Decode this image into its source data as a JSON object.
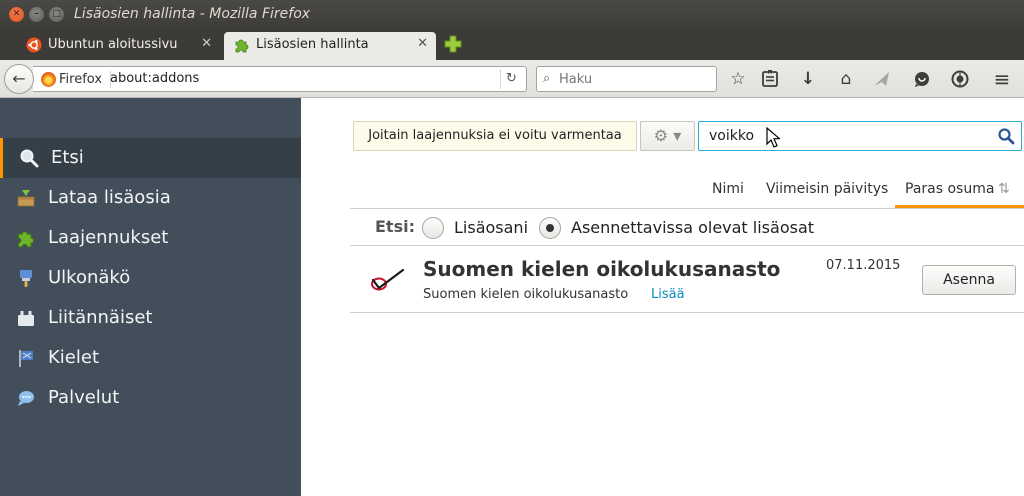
{
  "window": {
    "title": "Lisäosien hallinta - Mozilla Firefox",
    "close_glyph": "✕",
    "min_glyph": "–",
    "max_glyph": "□"
  },
  "tabs": [
    {
      "label": "Ubuntun aloitussivu",
      "icon": "ubuntu-icon",
      "close": "✕"
    },
    {
      "label": "Lisäosien hallinta",
      "icon": "puzzle-icon",
      "close": "✕"
    }
  ],
  "navbar": {
    "back_glyph": "←",
    "identity": "Firefox",
    "url": "about:addons",
    "reload_glyph": "↻",
    "search_placeholder": "Haku",
    "search_glyph": "⌕",
    "bookmark_glyph": "☆",
    "download_glyph": "↓",
    "home_glyph": "⌂",
    "menu_glyph": "≡"
  },
  "sidebar": {
    "items": [
      {
        "label": "Etsi",
        "icon": "search-icon",
        "selected": true
      },
      {
        "label": "Lataa lisäosia",
        "icon": "package-icon"
      },
      {
        "label": "Laajennukset",
        "icon": "puzzle-icon"
      },
      {
        "label": "Ulkonäkö",
        "icon": "brush-icon"
      },
      {
        "label": "Liitännäiset",
        "icon": "plugin-icon"
      },
      {
        "label": "Kielet",
        "icon": "language-flag-icon"
      },
      {
        "label": "Palvelut",
        "icon": "speech-bubble-icon"
      }
    ]
  },
  "main": {
    "warning": "Joitain laajennuksia ei voitu varmentaa",
    "gear_glyph": "⚙ ▾",
    "search_value": "voikko",
    "sort": {
      "name": "Nimi",
      "updated": "Viimeisin päivitys",
      "best": "Paras osuma",
      "best_arrow": "⇅"
    },
    "filter": {
      "label": "Etsi:",
      "option_mine": "Lisäosani",
      "option_available": "Asennettavissa olevat lisäosat",
      "selected": "option_available"
    },
    "result": {
      "name": "Suomen kielen oikolukusanasto",
      "date": "07.11.2015",
      "description": "Suomen kielen oikolukusanasto",
      "more": "Lisää",
      "install": "Asenna",
      "icon": "checkmark-icon"
    }
  },
  "colors": {
    "accent": "#ff9500",
    "sidebar_bg": "#424f5a",
    "link": "#0b8cc4",
    "search_border": "#2eaed6"
  }
}
